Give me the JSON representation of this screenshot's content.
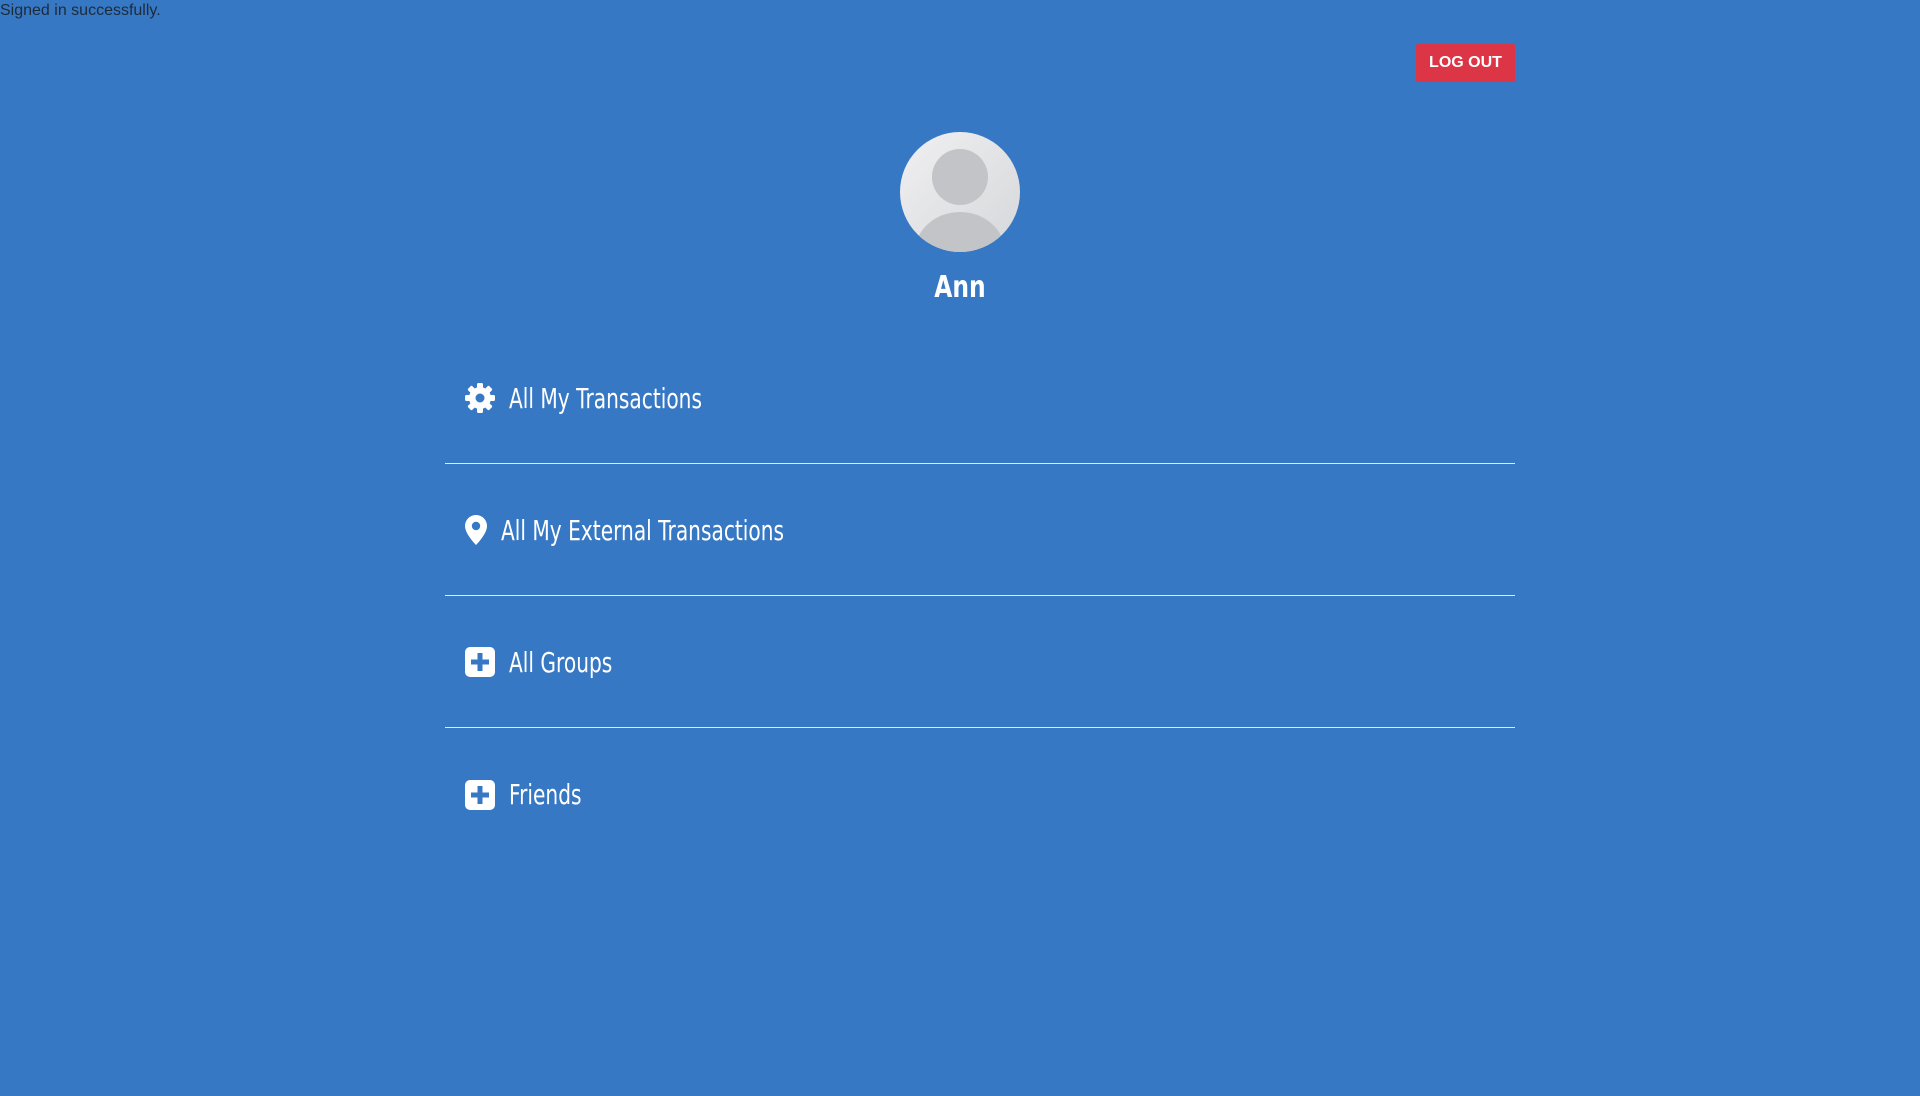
{
  "flash": {
    "message": "Signed in successfully."
  },
  "header": {
    "logout_label": "LOG OUT"
  },
  "profile": {
    "name": "Ann",
    "avatar_icon": "user-avatar-icon"
  },
  "menu": {
    "items": [
      {
        "label": "All My Transactions",
        "icon": "gear-icon"
      },
      {
        "label": "All My External Transactions",
        "icon": "map-pin-icon"
      },
      {
        "label": "All Groups",
        "icon": "plus-square-icon"
      },
      {
        "label": "Friends",
        "icon": "plus-square-icon"
      }
    ]
  },
  "colors": {
    "background": "#3778c4",
    "logout": "#dc3545",
    "text": "#ffffff"
  }
}
